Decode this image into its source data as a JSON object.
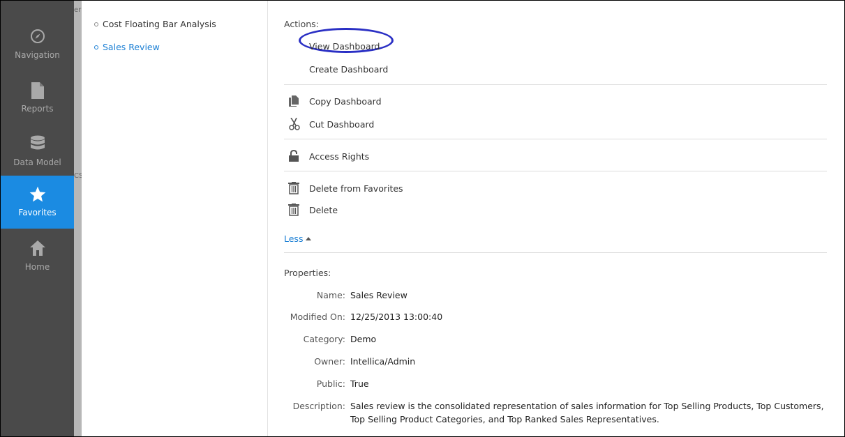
{
  "nav": {
    "items": [
      {
        "label": "Navigation",
        "icon": "compass-icon",
        "active": false
      },
      {
        "label": "Reports",
        "icon": "document-icon",
        "active": false
      },
      {
        "label": "Data Model",
        "icon": "database-icon",
        "active": false
      },
      {
        "label": "Favorites",
        "icon": "star-icon",
        "active": true
      },
      {
        "label": "Home",
        "icon": "home-icon",
        "active": false
      }
    ]
  },
  "strip": {
    "frag1": "er",
    "frag2": "CS"
  },
  "tree": {
    "items": [
      {
        "label": "Cost Floating Bar Analysis"
      },
      {
        "label": "Sales Review"
      }
    ]
  },
  "actions": {
    "heading": "Actions:",
    "view": "View Dashboard",
    "create": "Create Dashboard",
    "copy": "Copy Dashboard",
    "cut": "Cut Dashboard",
    "access": "Access Rights",
    "delete_fav": "Delete from Favorites",
    "delete": "Delete",
    "less": "Less"
  },
  "properties": {
    "heading": "Properties:",
    "name_key": "Name:",
    "name_val": "Sales Review",
    "modified_key": "Modified On:",
    "modified_val": "12/25/2013 13:00:40",
    "category_key": "Category:",
    "category_val": "Demo",
    "owner_key": "Owner:",
    "owner_val": "Intellica/Admin",
    "public_key": "Public:",
    "public_val": "True",
    "description_key": "Description:",
    "description_val": "Sales review is the consolidated representation of sales information for Top Selling Products, Top Customers, Top Selling Product Categories, and Top Ranked Sales Representatives."
  },
  "colors": {
    "accent": "#1b8be2",
    "link": "#1b7fd4",
    "nav_bg": "#4a4a4a",
    "annotation": "#2a2fc4"
  }
}
